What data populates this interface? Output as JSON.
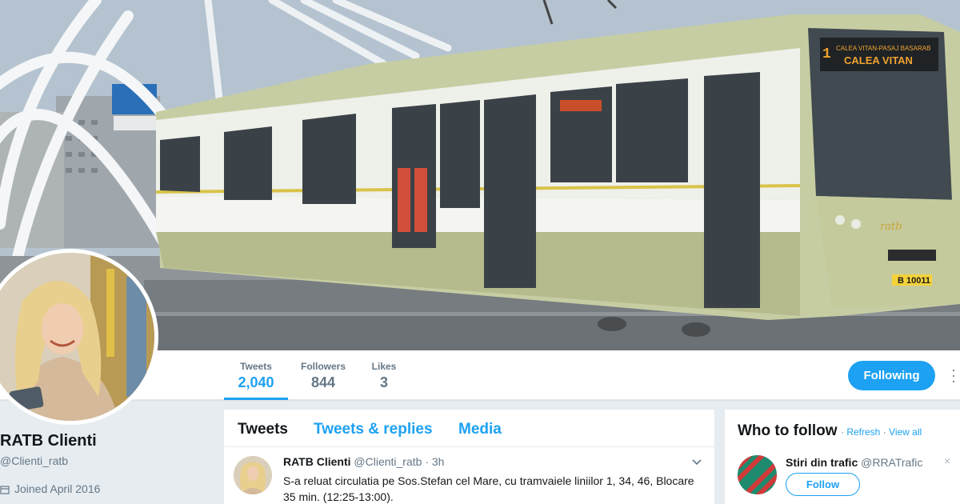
{
  "profile": {
    "name": "RATB Clienti",
    "handle": "@Clienti_ratb",
    "joined": "Joined April 2016"
  },
  "banner": {
    "tram_sign_route": "1",
    "tram_sign_line1": "CALEA VITAN-PASAJ BASARAB",
    "tram_sign_line2": "CALEA VITAN",
    "tram_plate": "B 10011",
    "tram_logo": "ratb",
    "accent_color": "#c9cfa3"
  },
  "stats": [
    {
      "label": "Tweets",
      "value": "2,040",
      "active": true
    },
    {
      "label": "Followers",
      "value": "844",
      "active": false
    },
    {
      "label": "Likes",
      "value": "3",
      "active": false
    }
  ],
  "actions": {
    "following_label": "Following",
    "more_icon": "more-vertical-icon"
  },
  "timeline": {
    "tabs": [
      {
        "label": "Tweets",
        "active": true
      },
      {
        "label": "Tweets & replies",
        "active": false
      },
      {
        "label": "Media",
        "active": false
      }
    ],
    "tweets": [
      {
        "name": "RATB Clienti",
        "handle": "@Clienti_ratb",
        "separator": "·",
        "time": "3h",
        "text": "S-a reluat circulatia pe Sos.Stefan cel Mare, cu tramvaiele liniilor 1, 34, 46, Blocare 35 min. (12:25-13:00)."
      }
    ]
  },
  "who_to_follow": {
    "title": "Who to follow",
    "separator": "·",
    "refresh_label": "Refresh",
    "view_all_label": "View all",
    "suggestions": [
      {
        "name": "Stiri din trafic",
        "handle": "@RRATrafic",
        "button_label": "Follow",
        "dismiss": "×"
      }
    ]
  },
  "colors": {
    "brand_blue": "#1da1f2",
    "secondary_text": "#657786",
    "page_bg": "#e6ecf0"
  }
}
